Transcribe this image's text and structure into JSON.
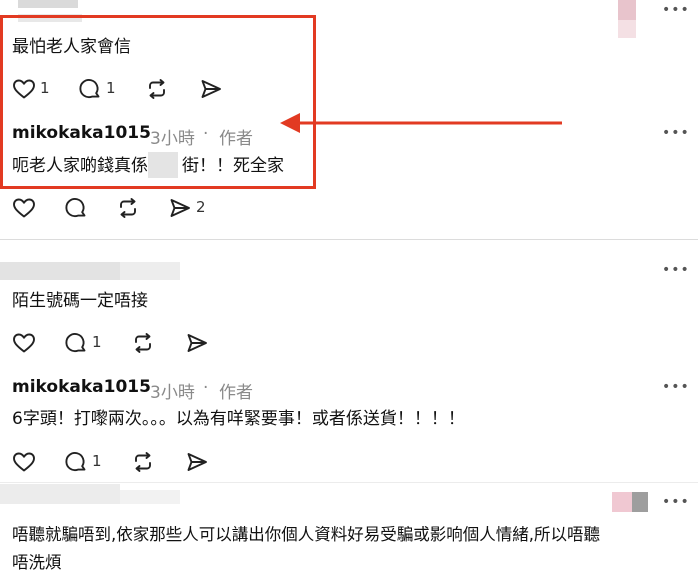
{
  "comments": [
    {
      "text": "最怕老人家會信",
      "like_count": "1",
      "reply_count": "1"
    },
    {
      "username": "mikokaka1015",
      "time": "3小時",
      "dot": "·",
      "role": "作者",
      "text_a": "呃老人家啲錢真係",
      "text_b": "街！！死全家",
      "share_count": "2"
    },
    {
      "text": "陌生號碼一定唔接",
      "reply_count": "1"
    },
    {
      "username": "mikokaka1015",
      "time": "3小時",
      "dot": "·",
      "role": "作者",
      "text": "6字頭！打嚟兩次。。。以為有咩緊要事！或者係送貨！！！！",
      "reply_count": "1"
    },
    {
      "text_line1": "唔聽就騙唔到,依家那些人可以講出你個人資料好易受騙或影响個人情緒,所以唔聽",
      "text_line2": "唔洗煩"
    }
  ],
  "more_label": "•••",
  "colors": {
    "highlight": "#e23a22",
    "meta": "#8a8a8a"
  }
}
